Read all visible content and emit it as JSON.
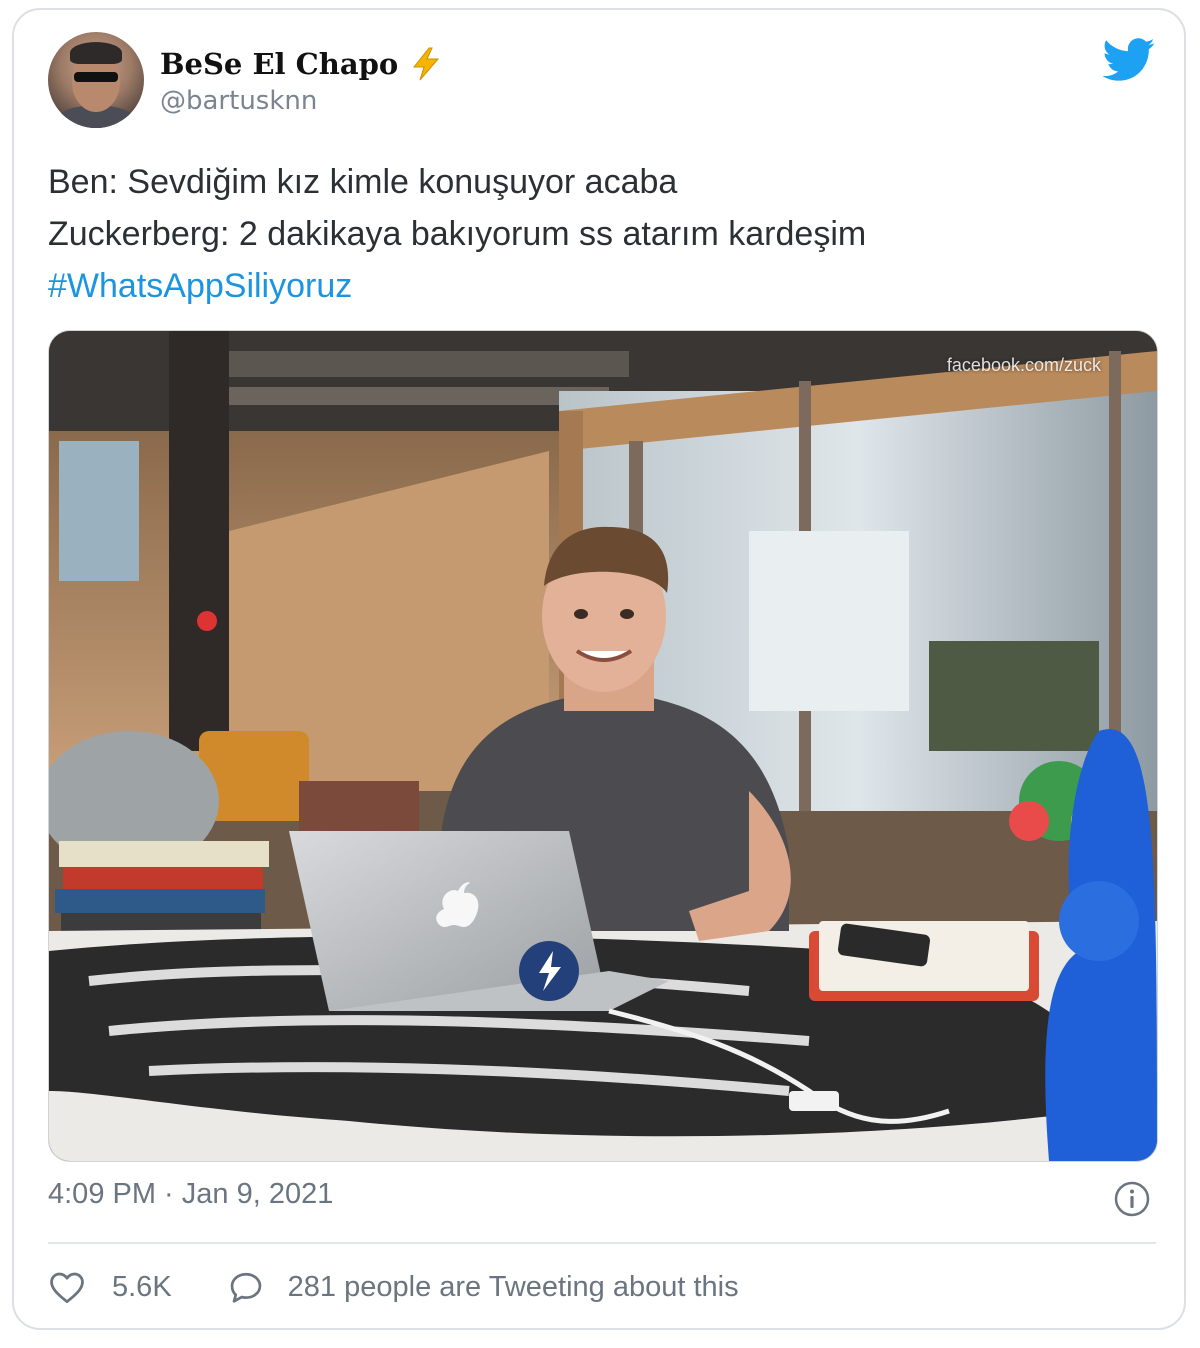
{
  "user": {
    "display_name": "BeSe El Chapo",
    "handle": "@bartusknn",
    "emoji_icon": "high-voltage-icon"
  },
  "tweet": {
    "lines": [
      "Ben: Sevdiğim kız kimle konuşuyor acaba",
      "Zuckerberg: 2 dakikaya bakıyorum ss atarım kardeşim"
    ],
    "hashtag": "#WhatsAppSiliyoruz",
    "image_watermark": "facebook.com/zuck",
    "timestamp": "4:09 PM · Jan 9, 2021"
  },
  "actions": {
    "like_count": "5.6K",
    "discussion_label": "281 people are Tweeting about this"
  },
  "colors": {
    "hashtag": "#1b95e0",
    "twitter_blue": "#1da1f2",
    "muted_text": "#6b7580"
  }
}
